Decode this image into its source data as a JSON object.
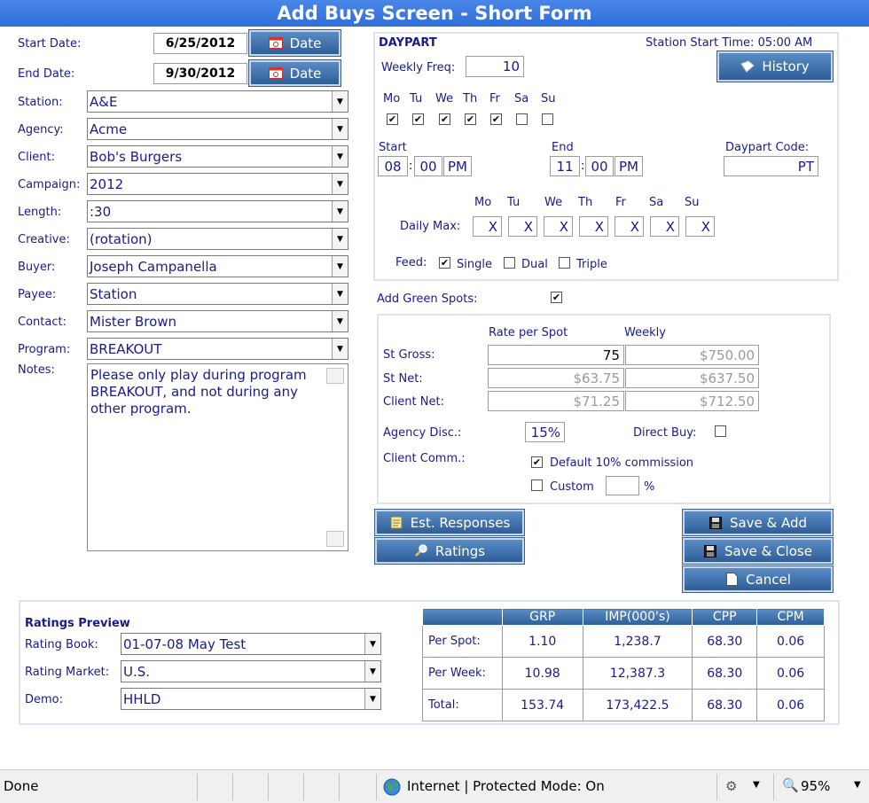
{
  "title": "Add Buys Screen - Short Form",
  "dates": {
    "start_label": "Start Date:",
    "start_value": "6/25/2012",
    "end_label": "End Date:",
    "end_value": "9/30/2012",
    "button_label": "Date"
  },
  "fields": [
    {
      "label": "Station:",
      "value": "A&E"
    },
    {
      "label": "Agency:",
      "value": "Acme"
    },
    {
      "label": "Client:",
      "value": "Bob's Burgers"
    },
    {
      "label": "Campaign:",
      "value": "2012"
    },
    {
      "label": "Length:",
      "value": ":30"
    },
    {
      "label": "Creative:",
      "value": "(rotation)"
    },
    {
      "label": "Buyer:",
      "value": "Joseph Campanella"
    },
    {
      "label": "Payee:",
      "value": "Station"
    },
    {
      "label": "Contact:",
      "value": "Mister Brown"
    },
    {
      "label": "Program:",
      "value": "BREAKOUT"
    }
  ],
  "notes": {
    "label": "Notes:",
    "value": "Please only play during program BREAKOUT, and not during any other program."
  },
  "daypart": {
    "heading": "DAYPART",
    "station_start": "Station Start Time: 05:00 AM",
    "history_label": "History",
    "weekly_freq_label": "Weekly Freq:",
    "weekly_freq_value": "10",
    "days": [
      "Mo",
      "Tu",
      "We",
      "Th",
      "Fr",
      "Sa",
      "Su"
    ],
    "days_checked": [
      true,
      true,
      true,
      true,
      true,
      false,
      false
    ],
    "start_label": "Start",
    "start_hour": "08",
    "start_min": "00",
    "start_ampm": "PM",
    "end_label": "End",
    "end_hour": "11",
    "end_min": "00",
    "end_ampm": "PM",
    "code_label": "Daypart Code:",
    "code_value": "PT",
    "daily_max_label": "Daily Max:",
    "daily_max": [
      "X",
      "X",
      "X",
      "X",
      "X",
      "X",
      "X"
    ],
    "feed_label": "Feed:",
    "feed_single": "Single",
    "feed_dual": "Dual",
    "feed_triple": "Triple"
  },
  "green_spots_label": "Add Green Spots:",
  "rates": {
    "col_rate": "Rate per Spot",
    "col_weekly": "Weekly",
    "st_gross_label": "St Gross:",
    "st_gross_rate": "75",
    "st_gross_weekly": "$750.00",
    "st_net_label": "St Net:",
    "st_net_rate": "$63.75",
    "st_net_weekly": "$637.50",
    "client_net_label": "Client Net:",
    "client_net_rate": "$71.25",
    "client_net_weekly": "$712.50",
    "agency_disc_label": "Agency Disc.:",
    "agency_disc_value": "15%",
    "direct_buy_label": "Direct Buy:",
    "client_comm_label": "Client Comm.:",
    "default_comm_label": "Default 10% commission",
    "custom_label": "Custom",
    "pct_sign": "%"
  },
  "buttons": {
    "est_responses": "Est. Responses",
    "ratings": "Ratings",
    "save_add": "Save & Add",
    "save_close": "Save & Close",
    "cancel": "Cancel"
  },
  "ratings_preview": {
    "heading": "Ratings Preview",
    "book_label": "Rating Book:",
    "book_value": "01-07-08 May Test",
    "market_label": "Rating Market:",
    "market_value": "U.S.",
    "demo_label": "Demo:",
    "demo_value": "HHLD"
  },
  "ratings_table": {
    "headers": [
      "",
      "GRP",
      "IMP(000's)",
      "CPP",
      "CPM"
    ],
    "rows": [
      [
        "Per Spot:",
        "1.10",
        "1,238.7",
        "68.30",
        "0.06"
      ],
      [
        "Per Week:",
        "10.98",
        "12,387.3",
        "68.30",
        "0.06"
      ],
      [
        "Total:",
        "153.74",
        "173,422.5",
        "68.30",
        "0.06"
      ]
    ]
  },
  "statusbar": {
    "status": "Done",
    "zone": "Internet | Protected Mode: On",
    "zoom": "95%"
  },
  "colors": {
    "title_bar": "#3a7ae0",
    "button": "#3d6ea8",
    "label_text": "#1a1a8c"
  }
}
